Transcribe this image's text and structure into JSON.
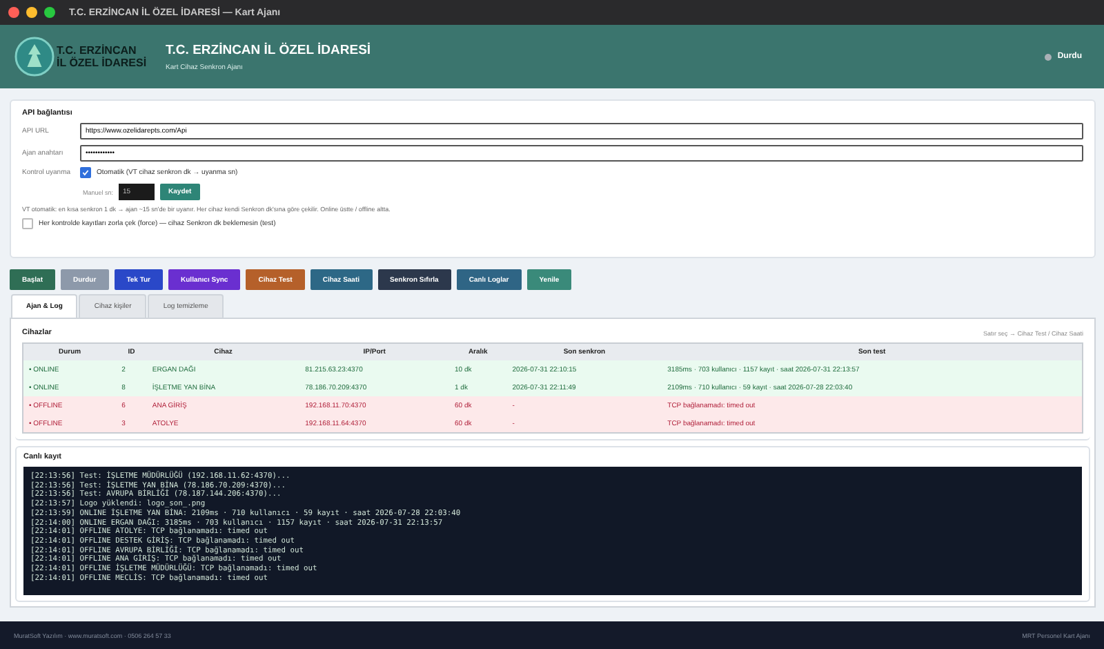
{
  "window": {
    "title": "T.C. ERZİNCAN İL ÖZEL İDARESİ — Kart Ajanı"
  },
  "header": {
    "logo_lines": [
      "T.C. ERZİNCAN",
      "İL ÖZEL İDARESİ"
    ],
    "title": "T.C. ERZİNCAN İL ÖZEL İDARESİ",
    "subtitle": "Kart Cihaz Senkron Ajanı",
    "status": {
      "label": "Durdu",
      "running": false
    }
  },
  "api": {
    "heading": "API bağlantısı",
    "fields": [
      {
        "label": "API URL",
        "value": "https://www.ozelidarepts.com/Api"
      },
      {
        "label": "Ajan anahtarı",
        "value": "••••••••••••"
      }
    ],
    "wake": {
      "label": "Kontrol uyanma",
      "checked": true,
      "text": "Otomatik (VT cihaz senkron dk → uyanma sn)"
    },
    "manual": {
      "label": "Manuel sn:",
      "value": "15",
      "button": "Kaydet"
    },
    "note": "VT otomatik: en kısa senkron 1 dk → ajan ~15 sn'de bir uyanır. Her cihaz kendi Senkron dk'sına göre çekilir. Online üstte / offline altta.",
    "force": {
      "checked": false,
      "text": "Her kontrolde kayıtları zorla çek (force) — cihaz Senkron dk beklemesin (test)"
    }
  },
  "buttons": [
    {
      "label": "Başlat",
      "color": "#2f6e55"
    },
    {
      "label": "Durdur",
      "color": "#8d99aa"
    },
    {
      "label": "Tek Tur",
      "color": "#2a48c8"
    },
    {
      "label": "Kullanıcı Sync",
      "color": "#6a2fd0"
    },
    {
      "label": "Cihaz Test",
      "color": "#b5602a"
    },
    {
      "label": "Cihaz Saati",
      "color": "#2d6886"
    },
    {
      "label": "Senkron Sıfırla",
      "color": "#2c384c"
    },
    {
      "label": "Canlı Loglar",
      "color": "#2f6585"
    },
    {
      "label": "Yenile",
      "color": "#3a8a7a"
    }
  ],
  "tabs": [
    {
      "label": "Ajan & Log",
      "selected": true
    },
    {
      "label": "Cihaz kişiler",
      "selected": false
    },
    {
      "label": "Log temizleme",
      "selected": false
    }
  ],
  "devices": {
    "title": "Cihazlar",
    "hint": "Satır seç → Cihaz Test / Cihaz Saati",
    "columns": [
      "Durum",
      "ID",
      "Cihaz",
      "IP/Port",
      "Aralık",
      "Son senkron",
      "Son test"
    ],
    "rows": [
      {
        "online": true,
        "cells": [
          "• ONLINE",
          "2",
          "ERGAN DAĞI",
          "81.215.63.23:4370",
          "10 dk",
          "2026-07-31 22:10:15",
          "3185ms · 703 kullanıcı · 1157 kayıt · saat 2026-07-31 22:13:57"
        ]
      },
      {
        "online": true,
        "cells": [
          "• ONLINE",
          "8",
          "İŞLETME YAN BİNA",
          "78.186.70.209:4370",
          "1 dk",
          "2026-07-31 22:11:49",
          "2109ms · 710 kullanıcı · 59 kayıt · saat 2026-07-28 22:03:40"
        ]
      },
      {
        "online": false,
        "cells": [
          "• OFFLINE",
          "6",
          "ANA GİRİŞ",
          "192.168.11.70:4370",
          "60 dk",
          "-",
          "TCP bağlanamadı: timed out"
        ]
      },
      {
        "online": false,
        "cells": [
          "• OFFLINE",
          "3",
          "ATOLYE",
          "192.168.11.64:4370",
          "60 dk",
          "-",
          "TCP bağlanamadı: timed out"
        ]
      }
    ]
  },
  "log": {
    "title": "Canlı kayıt",
    "lines": [
      "[22:13:56] Test: İŞLETME MÜDÜRLÜĞÜ (192.168.11.62:4370)...",
      "[22:13:56] Test: İŞLETME YAN BİNA (78.186.70.209:4370)...",
      "[22:13:56] Test: AVRUPA BİRLİĞİ (78.187.144.206:4370)...",
      "[22:13:57] Logo yüklendi: logo_son_.png",
      "[22:13:59] ONLINE İŞLETME YAN BİNA: 2109ms · 710 kullanıcı · 59 kayıt · saat 2026-07-28 22:03:40",
      "[22:14:00] ONLINE ERGAN DAĞI: 3185ms · 703 kullanıcı · 1157 kayıt · saat 2026-07-31 22:13:57",
      "[22:14:01] OFFLINE ATOLYE: TCP bağlanamadı: timed out",
      "[22:14:01] OFFLINE DESTEK GİRİŞ: TCP bağlanamadı: timed out",
      "[22:14:01] OFFLINE AVRUPA BİRLİĞİ: TCP bağlanamadı: timed out",
      "[22:14:01] OFFLINE ANA GİRİŞ: TCP bağlanamadı: timed out",
      "[22:14:01] OFFLINE İŞLETME MÜDÜRLÜĞÜ: TCP bağlanamadı: timed out",
      "[22:14:01] OFFLINE MECLİS: TCP bağlanamadı: timed out"
    ]
  },
  "footer": {
    "left": "MuratSoft Yazılım · www.muratsoft.com · 0506 264 57 33",
    "right": "MRT Personel Kart Ajanı"
  }
}
